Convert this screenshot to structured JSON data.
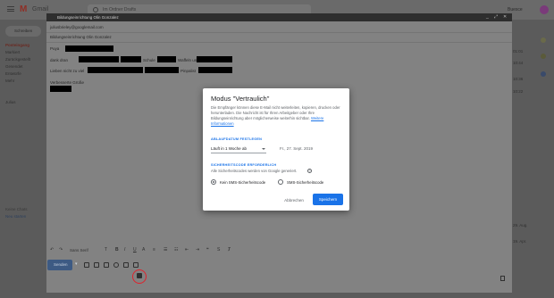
{
  "gmail": {
    "logo_text": "Gmail",
    "search_text": "Im Ordner Drafts",
    "account_name": "Buesce",
    "compose_label": "Schreiben",
    "sidebar_items": [
      "Posteingang",
      "Markiert",
      "Zurückgestellt",
      "Gesendet",
      "Entwürfe",
      "Mehr",
      "Julius"
    ],
    "list_meta": [
      "01:01",
      "10:44",
      "10:36",
      "10:22",
      "29. Aug.",
      "19. Apr."
    ],
    "meet_label": "Keine Chats",
    "meet_sub": "Neu starten"
  },
  "compose": {
    "title": "Bildungseinrichtung Olin Gonzalez",
    "to": "juliusbrieley@googlemail.com",
    "subject": "Bildungseinrichtung Olin Gonzalez",
    "body_lines": {
      "greeting": "Puya",
      "line2_prefix": "dank dran",
      "line2_mid": "Schule",
      "line2_suffix": "Waffeln und",
      "line3_prefix": "Lieben nicht zu viel",
      "line3_suffix": "Pinpalist",
      "signature": "Verbesserte Grüße"
    },
    "font_label": "Sans Serif",
    "send_label": "Senden"
  },
  "dialog": {
    "title": "Modus \"Vertraulich\"",
    "description": "Die Empfänger können diese E-Mail nicht weiterleiten, kopieren, drucken oder herunterladen. Die Nachricht ist für Ihren Arbeitgeber oder Ihre Bildungseinrichtung aber möglicherweise weiterhin sichtbar.",
    "link_text": "Weitere Informationen",
    "expiry_section": "ABLAUFDATUM FESTLEGEN",
    "expiry_value": "Läuft in 1 Woche ab",
    "expiry_date": "Fr., 27. Sept. 2019",
    "passcode_section": "SICHERHEITSCODE ERFORDERLICH",
    "passcode_note": "Alle Sicherheitscodes werden von Google generiert.",
    "help_symbol": "?",
    "option_none": "Kein SMS-Sicherheitscode",
    "option_sms": "SMS-Sicherheitscode",
    "selected_option": "option_none",
    "cancel_label": "Abbrechen",
    "save_label": "Speichern",
    "accent_color": "#1a73e8"
  }
}
